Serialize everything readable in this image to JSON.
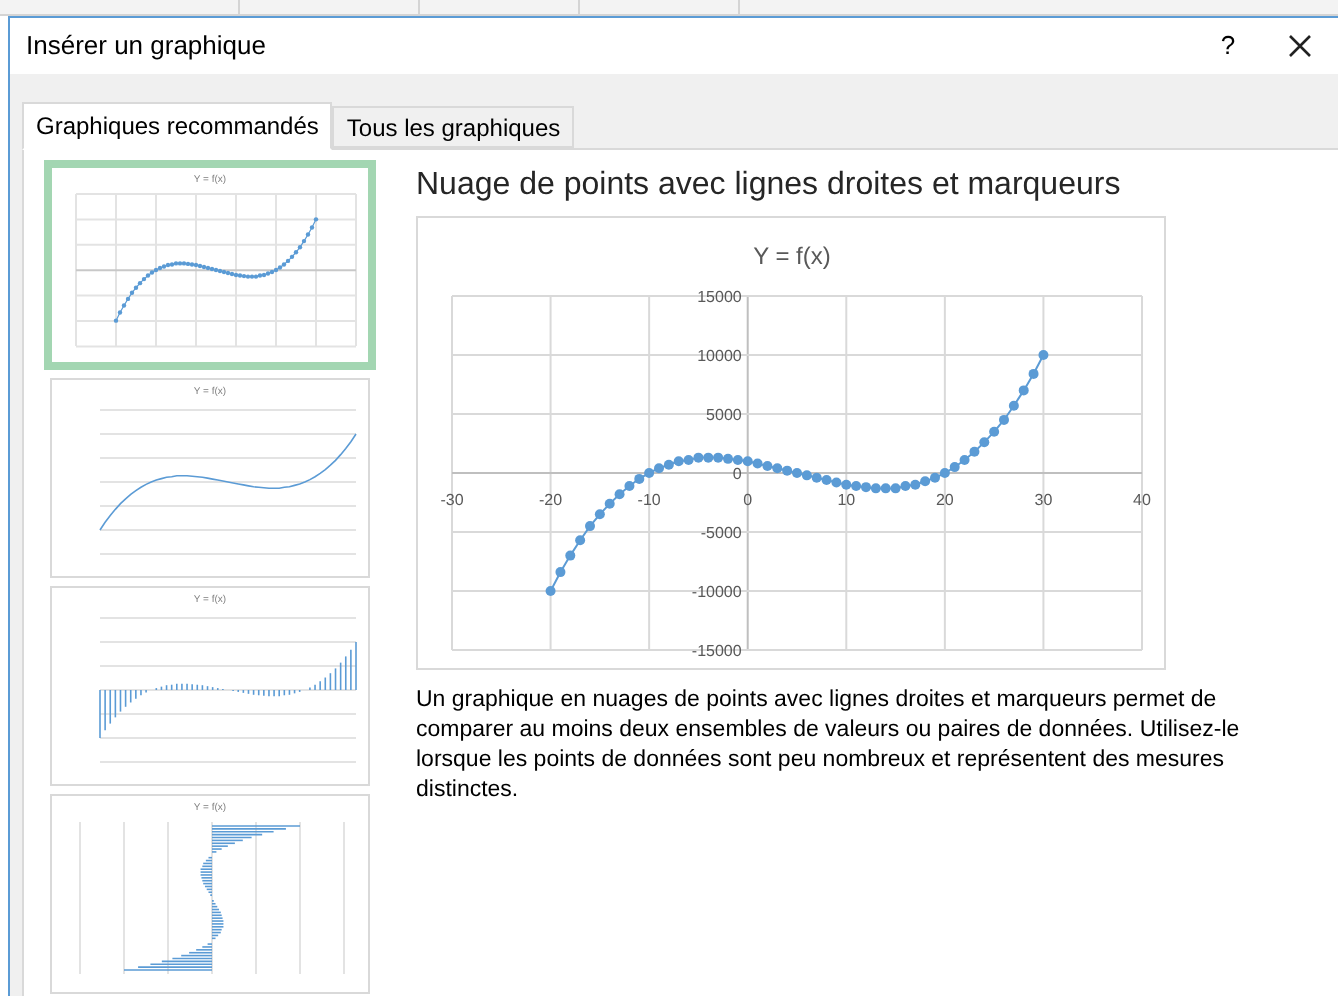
{
  "dialog": {
    "title": "Insérer un graphique",
    "help_button": "?"
  },
  "tabs": [
    {
      "label": "Graphiques recommandés",
      "selected": true
    },
    {
      "label": "Tous les graphiques",
      "selected": false
    }
  ],
  "thumbnails": [
    {
      "kind": "scatter",
      "title": "Y = f(x)",
      "selected": true
    },
    {
      "kind": "line",
      "title": "Y = f(x)",
      "selected": false
    },
    {
      "kind": "column",
      "title": "Y = f(x)",
      "selected": false
    },
    {
      "kind": "bar",
      "title": "Y = f(x)",
      "selected": false
    }
  ],
  "preview": {
    "heading": "Nuage de points avec lignes droites et marqueurs",
    "chart_data": {
      "type": "line",
      "title": "Y = f(x)",
      "x": [
        -20,
        -19,
        -18,
        -17,
        -16,
        -15,
        -14,
        -13,
        -12,
        -11,
        -10,
        -9,
        -8,
        -7,
        -6,
        -5,
        -4,
        -3,
        -2,
        -1,
        0,
        1,
        2,
        3,
        4,
        5,
        6,
        7,
        8,
        9,
        10,
        11,
        12,
        13,
        14,
        15,
        16,
        17,
        18,
        19,
        20,
        21,
        22,
        23,
        24,
        25,
        26,
        27,
        28,
        29,
        30
      ],
      "series": [
        {
          "color": "#5b9bd5",
          "marker": "circle",
          "values": [
            -10000,
            -8400,
            -7000,
            -5700,
            -4500,
            -3500,
            -2600,
            -1800,
            -1100,
            -500,
            0,
            400,
            700,
            1000,
            1100,
            1300,
            1300,
            1300,
            1200,
            1100,
            1000,
            800,
            600,
            400,
            200,
            0,
            -200,
            -400,
            -600,
            -800,
            -1000,
            -1100,
            -1200,
            -1300,
            -1300,
            -1300,
            -1100,
            -1000,
            -700,
            -400,
            0,
            500,
            1100,
            1800,
            2600,
            3500,
            4500,
            5700,
            7000,
            8400,
            10000
          ]
        }
      ],
      "grid": true,
      "xlim": [
        -30,
        40
      ],
      "ylim": [
        -15000,
        15000
      ],
      "xticks": [
        -30,
        -20,
        -10,
        0,
        10,
        20,
        30,
        40
      ],
      "yticks": [
        -15000,
        -10000,
        -5000,
        0,
        5000,
        10000,
        15000
      ]
    }
  },
  "description": "Un graphique en nuages de points avec lignes droites et marqueurs permet de comparer au moins deux ensembles de valeurs ou paires de données. Utilisez-le lorsque les points de données sont peu nombreux et représentent des mesures distinctes."
}
